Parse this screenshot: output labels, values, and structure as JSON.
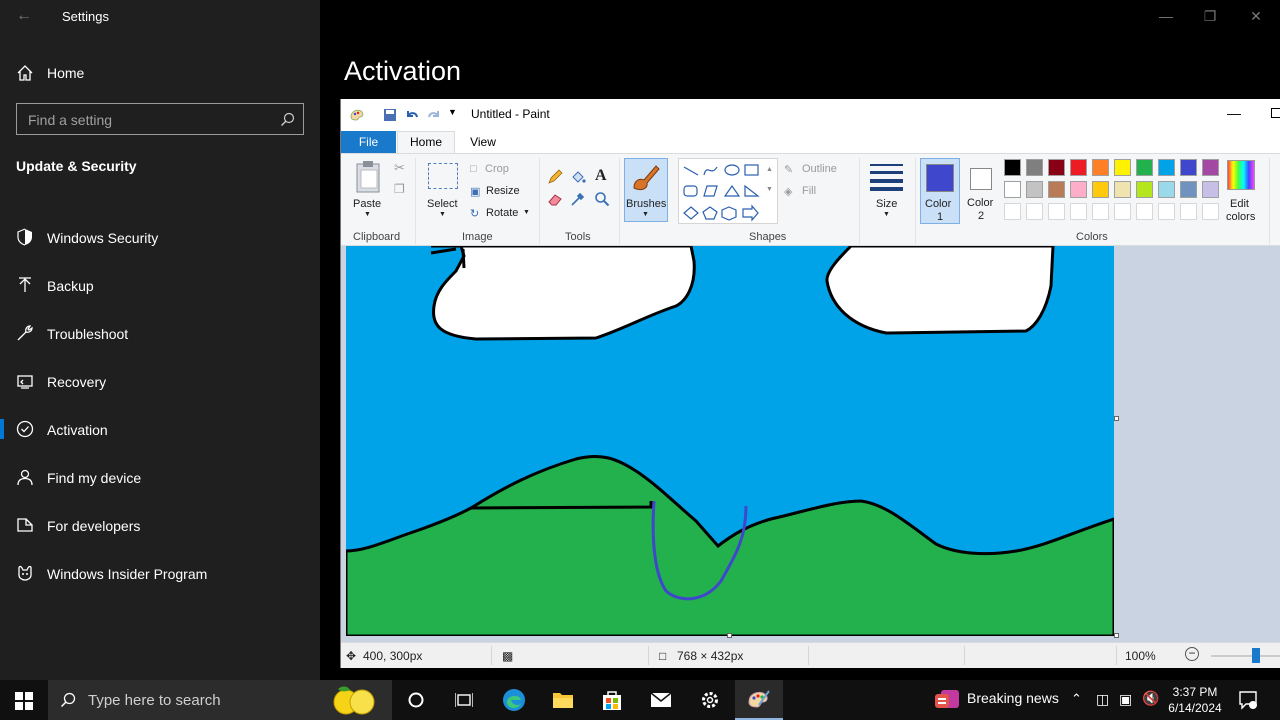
{
  "settings": {
    "window_title": "Settings",
    "home_label": "Home",
    "search_placeholder": "Find a setting",
    "section_title": "Update & Security",
    "nav_items": [
      {
        "label": "Windows Security",
        "icon": "shield-icon"
      },
      {
        "label": "Backup",
        "icon": "backup-icon"
      },
      {
        "label": "Troubleshoot",
        "icon": "wrench-icon"
      },
      {
        "label": "Recovery",
        "icon": "recovery-icon"
      },
      {
        "label": "Activation",
        "icon": "check-circle-icon",
        "active": true
      },
      {
        "label": "Find my device",
        "icon": "person-icon"
      },
      {
        "label": "For developers",
        "icon": "developer-icon"
      },
      {
        "label": "Windows Insider Program",
        "icon": "insider-icon"
      }
    ],
    "page_title": "Activation",
    "accent_color": "#0078d4"
  },
  "paint": {
    "title": "Untitled - Paint",
    "tabs": {
      "file": "File",
      "home": "Home",
      "view": "View"
    },
    "clipboard": {
      "paste": "Paste",
      "group": "Clipboard"
    },
    "image": {
      "select": "Select",
      "crop": "Crop",
      "resize": "Resize",
      "rotate": "Rotate",
      "group": "Image"
    },
    "tools": {
      "group": "Tools"
    },
    "brushes": {
      "label": "Brushes"
    },
    "shapes": {
      "outline": "Outline",
      "fill": "Fill",
      "group": "Shapes"
    },
    "size": {
      "label": "Size"
    },
    "colors": {
      "color1_label": "Color",
      "color1_num": "1",
      "color2_label": "Color",
      "color2_num": "2",
      "edit_label": "Edit",
      "edit_label2": "colors",
      "group": "Colors",
      "color1": "#3f48cc",
      "color2": "#ffffff",
      "palette_row1": [
        "#000000",
        "#7f7f7f",
        "#880015",
        "#ed1c24",
        "#ff7f27",
        "#fff200",
        "#22b14c",
        "#00a2e8",
        "#3f48cc",
        "#a349a4"
      ],
      "palette_row2": [
        "#ffffff",
        "#c3c3c3",
        "#b97a57",
        "#ffaec9",
        "#ffc90e",
        "#efe4b0",
        "#b5e61d",
        "#99d9ea",
        "#7092be",
        "#c8bfe7"
      ]
    },
    "status": {
      "cursor": "400, 300px",
      "canvas_size": "768 × 432px",
      "zoom": "100%"
    }
  },
  "taskbar": {
    "search_placeholder": "Type here to search",
    "news": "Breaking news",
    "time": "3:37 PM",
    "date": "6/14/2024"
  }
}
